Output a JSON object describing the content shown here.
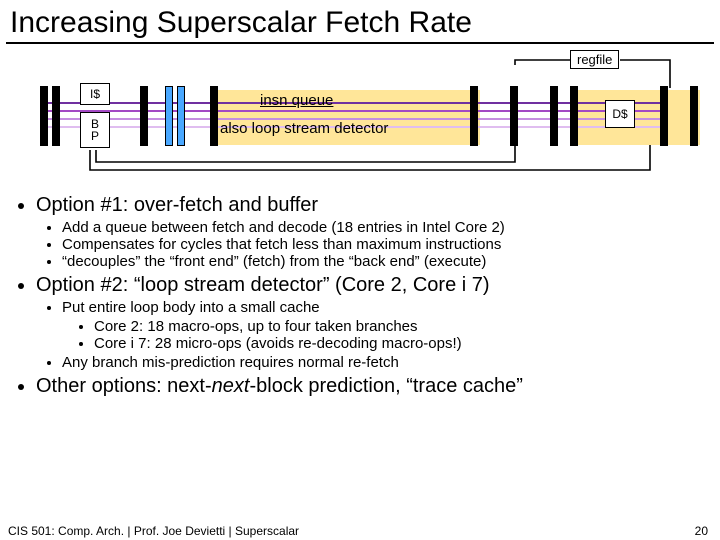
{
  "title": "Increasing Superscalar Fetch Rate",
  "diagram": {
    "regfile": "regfile",
    "icache": "I$",
    "bp": "B\nP",
    "insn_queue": "insn queue",
    "loop_detector": "also loop stream detector",
    "dcache": "D$"
  },
  "bullets": {
    "opt1": {
      "head": "Option #1: over-fetch and buffer",
      "items": [
        "Add a queue between fetch and decode (18 entries in Intel Core 2)",
        "Compensates for cycles that fetch less than maximum instructions",
        "“decouples” the “front end” (fetch) from the “back end” (execute)"
      ]
    },
    "opt2": {
      "head": "Option #2: “loop stream detector” (Core 2, Core i 7)",
      "items": [
        "Put entire loop body into a small cache",
        "Core 2: 18 macro-ops, up to four taken branches",
        "Core i 7: 28 micro-ops (avoids re-decoding macro-ops!)",
        "Any branch mis-prediction requires normal re-fetch"
      ]
    },
    "opt3": "Other options: next-next-block prediction, “trace cache”"
  },
  "footer": {
    "left": "CIS 501: Comp. Arch.  |  Prof. Joe Devietti  |  Superscalar",
    "page": "20"
  }
}
